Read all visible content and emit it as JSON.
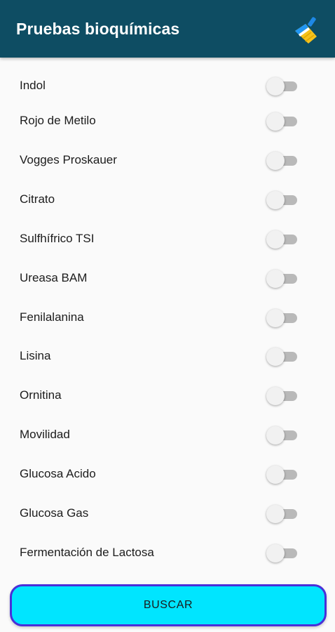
{
  "app_bar": {
    "title": "Pruebas bioquímicas",
    "action_icon": "broom-icon",
    "background": "#0e4d63"
  },
  "tests": [
    {
      "label": "Indol",
      "enabled": false
    },
    {
      "label": "Rojo de Metilo",
      "enabled": false
    },
    {
      "label": "Vogges Proskauer",
      "enabled": false
    },
    {
      "label": "Citrato",
      "enabled": false
    },
    {
      "label": "Sulfhífrico TSI",
      "enabled": false
    },
    {
      "label": "Ureasa BAM",
      "enabled": false
    },
    {
      "label": "Fenilalanina",
      "enabled": false
    },
    {
      "label": "Lisina",
      "enabled": false
    },
    {
      "label": "Ornitina",
      "enabled": false
    },
    {
      "label": "Movilidad",
      "enabled": false
    },
    {
      "label": "Glucosa Acido",
      "enabled": false
    },
    {
      "label": "Glucosa Gas",
      "enabled": false
    },
    {
      "label": "Fermentación de Lactosa",
      "enabled": false
    }
  ],
  "search_button": {
    "label": "BUSCAR",
    "background": "#00e5ff",
    "border": "#4a2fd8"
  }
}
